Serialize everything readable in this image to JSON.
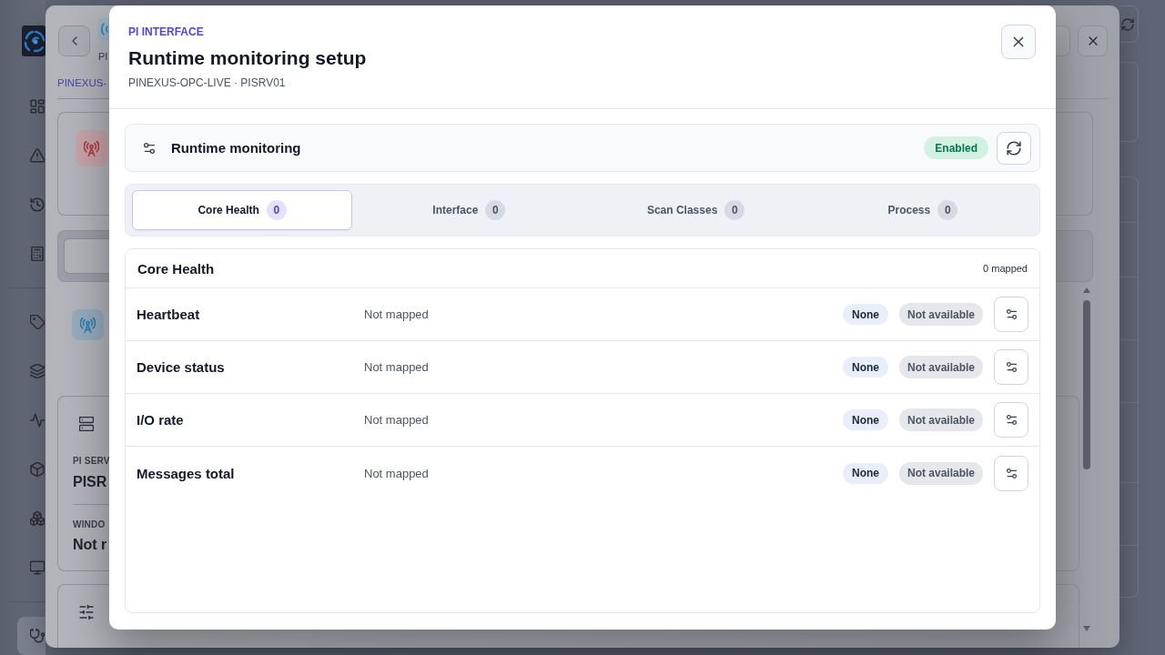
{
  "sidebar": {
    "groups": [
      {
        "items": [
          {
            "selected": false
          },
          {
            "selected": false
          },
          {
            "selected": false
          },
          {
            "selected": false
          }
        ]
      },
      {
        "items": [
          {
            "selected": false
          },
          {
            "selected": false
          },
          {
            "selected": false
          },
          {
            "selected": false
          },
          {
            "selected": false
          },
          {
            "selected": false
          }
        ]
      },
      {
        "items": [
          {
            "selected": true
          }
        ]
      }
    ]
  },
  "background_dialog": {
    "caption": "PI",
    "breadcrumb": "PINEXUS-",
    "fields": [
      {
        "label": "PI SERV",
        "value": "PISR"
      },
      {
        "label": "WINDO",
        "value": "Not r"
      }
    ]
  },
  "dialog": {
    "eyebrow": "PI INTERFACE",
    "title": "Runtime monitoring setup",
    "subtitle": "PINEXUS-OPC-LIVE · PISRV01",
    "monitoring": {
      "label": "Runtime monitoring",
      "status": "Enabled",
      "enabled": true
    },
    "tabs": [
      {
        "label": "Core Health",
        "count": "0",
        "selected": true
      },
      {
        "label": "Interface",
        "count": "0",
        "selected": false
      },
      {
        "label": "Scan Classes",
        "count": "0",
        "selected": false
      },
      {
        "label": "Process",
        "count": "0",
        "selected": false
      }
    ],
    "panel": {
      "title": "Core Health",
      "summary": "0 mapped",
      "rows": [
        {
          "name": "Heartbeat",
          "mapping": "Not mapped",
          "badges": [
            {
              "kind": "type",
              "text": "None"
            },
            {
              "kind": "status",
              "text": "Not available"
            }
          ]
        },
        {
          "name": "Device status",
          "mapping": "Not mapped",
          "badges": [
            {
              "kind": "type",
              "text": "None"
            },
            {
              "kind": "status",
              "text": "Not available"
            }
          ]
        },
        {
          "name": "I/O rate",
          "mapping": "Not mapped",
          "badges": [
            {
              "kind": "type",
              "text": "None"
            },
            {
              "kind": "status",
              "text": "Not available"
            }
          ]
        },
        {
          "name": "Messages total",
          "mapping": "Not mapped",
          "badges": [
            {
              "kind": "type",
              "text": "None"
            },
            {
              "kind": "status",
              "text": "Not available"
            }
          ]
        }
      ]
    }
  }
}
